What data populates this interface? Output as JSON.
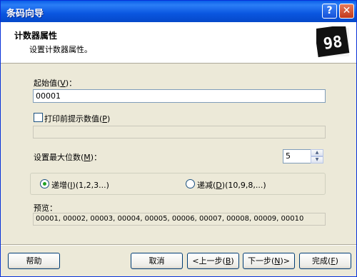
{
  "window": {
    "title": "条码向导",
    "help_button": "?",
    "close_button": "✕"
  },
  "header": {
    "title": "计数器属性",
    "subtitle": "设置计数器属性。",
    "logo_text": "98"
  },
  "start_value": {
    "label": "起始值(",
    "mnemonic": "V",
    "label_end": ")：",
    "value": "00001"
  },
  "prompt_checkbox": {
    "label": "打印前提示数值(",
    "mnemonic": "P",
    "label_end": ")",
    "checked": false,
    "field_value": ""
  },
  "max_digits": {
    "label": "设置最大位数(",
    "mnemonic": "M",
    "label_end": ")：",
    "value": "5"
  },
  "direction": {
    "increment": {
      "label": "递增(",
      "mnemonic": "I",
      "label_end": ")(1,2,3...)",
      "selected": true
    },
    "decrement": {
      "label": "递减(",
      "mnemonic": "D",
      "label_end": ")(10,9,8,...)",
      "selected": false
    }
  },
  "preview": {
    "label": "预览：",
    "value": "00001, 00002, 00003, 00004, 00005, 00006, 00007, 00008, 00009, 00010"
  },
  "buttons": {
    "help": "帮助",
    "cancel": "取消",
    "back_pre": "<上一步(",
    "back_mn": "B",
    "back_post": ")",
    "next_pre": "下一步(",
    "next_mn": "N",
    "next_post": ")>",
    "finish_pre": "完成(",
    "finish_mn": "F",
    "finish_post": ")"
  }
}
